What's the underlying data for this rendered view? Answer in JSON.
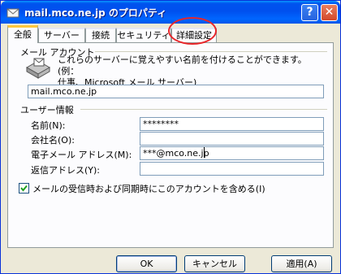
{
  "window": {
    "title": "mail.mco.ne.jp のプロパティ",
    "help_label": "?",
    "close_label": "✕"
  },
  "tabs": [
    {
      "label": "全般",
      "active": true
    },
    {
      "label": "サーバー",
      "active": false
    },
    {
      "label": "接続",
      "active": false
    },
    {
      "label": "セキュリティ",
      "active": false
    },
    {
      "label": "詳細設定",
      "active": false
    }
  ],
  "mail_account": {
    "section_label": "メール アカウント",
    "description_line1": "これらのサーバーに覚えやすい名前を付けることができます。(例：",
    "description_line2": "仕事、Microsoft メール サーバー)",
    "account_name": "mail.mco.ne.jp",
    "icon": "mail-account-icon"
  },
  "user_info": {
    "section_label": "ユーザー情報",
    "fields": [
      {
        "label": "名前(N):",
        "value": "********"
      },
      {
        "label": "会社名(O):",
        "value": ""
      },
      {
        "label": "電子メール アドレス(M):",
        "value": "***@mco.ne.jp"
      },
      {
        "label": "返信アドレス(Y):",
        "value": ""
      }
    ]
  },
  "include_account": {
    "label": "メールの受信時および同期時にこのアカウントを含める(I)",
    "checked": true
  },
  "buttons": {
    "ok": "OK",
    "cancel": "キャンセル",
    "apply": "適用(A)"
  },
  "annotation_color": "#e8262a",
  "accent_color": "#0053ee"
}
